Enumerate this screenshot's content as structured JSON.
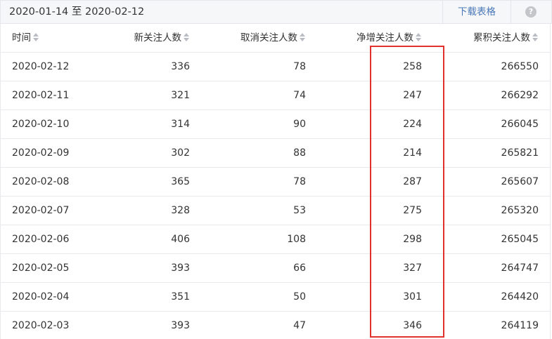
{
  "topbar": {
    "date_range": "2020-01-14 至 2020-02-12",
    "download_label": "下载表格",
    "help_glyph": "?"
  },
  "table": {
    "columns": [
      "时间",
      "新关注人数",
      "取消关注人数",
      "净增关注人数",
      "累积关注人数"
    ],
    "rows": [
      [
        "2020-02-12",
        "336",
        "78",
        "258",
        "266550"
      ],
      [
        "2020-02-11",
        "321",
        "74",
        "247",
        "266292"
      ],
      [
        "2020-02-10",
        "314",
        "90",
        "224",
        "266045"
      ],
      [
        "2020-02-09",
        "302",
        "88",
        "214",
        "265821"
      ],
      [
        "2020-02-08",
        "365",
        "78",
        "287",
        "265607"
      ],
      [
        "2020-02-07",
        "328",
        "53",
        "275",
        "265320"
      ],
      [
        "2020-02-06",
        "406",
        "108",
        "298",
        "265045"
      ],
      [
        "2020-02-05",
        "393",
        "66",
        "327",
        "264747"
      ],
      [
        "2020-02-04",
        "351",
        "50",
        "301",
        "264420"
      ],
      [
        "2020-02-03",
        "393",
        "47",
        "346",
        "264119"
      ]
    ]
  },
  "colors": {
    "highlight": "#e0312d",
    "link": "#4a78b8",
    "header_bg": "#f6f7f9"
  }
}
